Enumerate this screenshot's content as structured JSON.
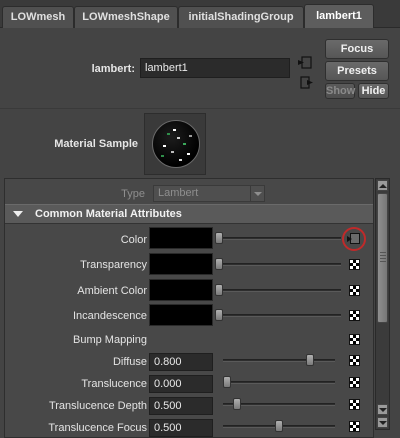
{
  "tabs": [
    {
      "label": "LOWmesh"
    },
    {
      "label": "LOWmeshShape"
    },
    {
      "label": "initialShadingGroup"
    },
    {
      "label": "lambert1"
    }
  ],
  "node": {
    "label": "lambert:",
    "name_value": "lambert1"
  },
  "buttons": {
    "focus": "Focus",
    "presets": "Presets",
    "show": "Show",
    "hide": "Hide"
  },
  "sample": {
    "label": "Material Sample"
  },
  "type": {
    "label": "Type",
    "value": "Lambert"
  },
  "section": {
    "title": "Common Material Attributes"
  },
  "color_attrs": [
    {
      "label": "Color"
    },
    {
      "label": "Transparency"
    },
    {
      "label": "Ambient Color"
    },
    {
      "label": "Incandescence"
    }
  ],
  "bump": {
    "label": "Bump Mapping"
  },
  "numeric_attrs": [
    {
      "label": "Diffuse",
      "value": "0.800",
      "level": 0.8
    },
    {
      "label": "Translucence",
      "value": "0.000",
      "level": 0.0
    },
    {
      "label": "Translucence Depth",
      "value": "0.500",
      "level": 0.1
    },
    {
      "label": "Translucence Focus",
      "value": "0.500",
      "level": 0.5
    }
  ],
  "icons": {
    "map": "map-button-icon",
    "checker": "texture-checker-icon",
    "input": "input-connection-icon",
    "output": "output-connection-icon"
  },
  "colors": {
    "highlight_circle": "#c02a2a"
  }
}
